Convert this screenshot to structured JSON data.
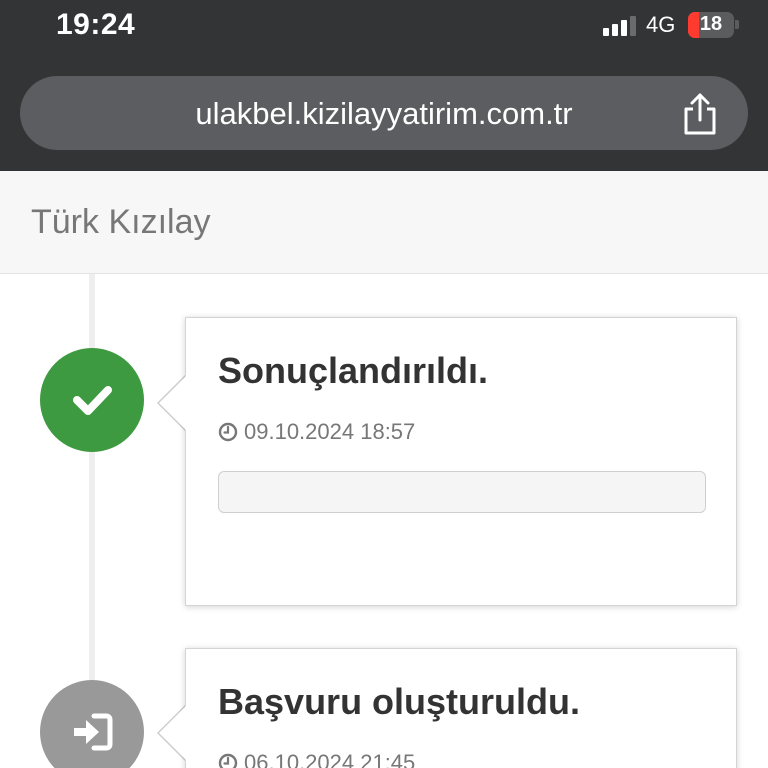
{
  "status_bar": {
    "time": "19:24",
    "network": "4G",
    "battery": "18",
    "battery_level_percent": 18,
    "colors": {
      "battery_low": "#ff3b30"
    }
  },
  "browser": {
    "url": "ulakbel.kizilayyatirim.com.tr",
    "share_icon": "share-icon"
  },
  "header": {
    "brand": "Türk Kızılay"
  },
  "timeline": {
    "items": [
      {
        "title": "Sonuçlandırıldı.",
        "datetime": "09.10.2024 18:57",
        "icon": "check-icon",
        "badge_color": "#3d9a41"
      },
      {
        "title": "Başvuru oluşturuldu.",
        "datetime": "06.10.2024 21:45",
        "icon": "sign-in-icon",
        "badge_color": "#999999"
      }
    ]
  }
}
